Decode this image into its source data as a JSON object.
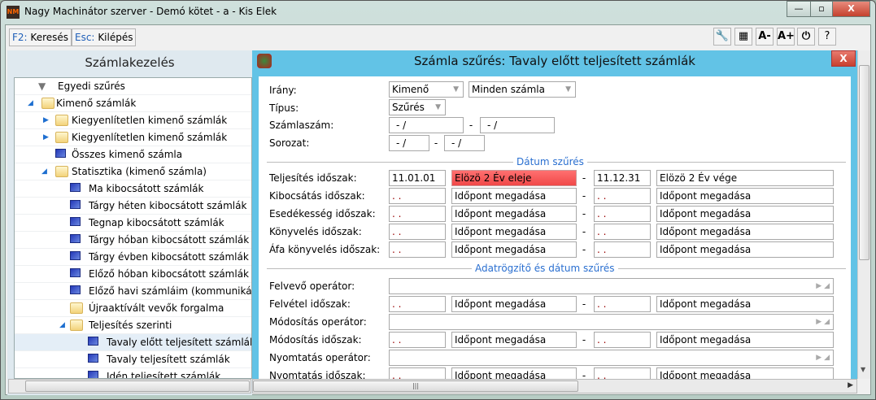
{
  "window": {
    "title": "Nagy Machinátor szerver - Demó kötet - a - Kis Elek",
    "app_icon": "NM",
    "minimize": "—",
    "maximize": "▫",
    "close": "X"
  },
  "toolbar": {
    "search_key": "F2:",
    "search_label": "Keresés",
    "exit_key": "Esc:",
    "exit_label": "Kilépés",
    "icons": {
      "settings": "wrench-icon",
      "layout": "grid-icon",
      "font_smaller": "A-",
      "font_larger": "A+",
      "power": "power-icon",
      "help": "?"
    }
  },
  "sidebar": {
    "title": "Számlakezelés",
    "items": [
      {
        "label": "Egyedi szűrés",
        "icon": "filter",
        "level": 0
      },
      {
        "label": "Kimenő számlák",
        "icon": "folder",
        "level": 0,
        "expanded": true
      },
      {
        "label": "Kiegyenlítetlen kimenő számlák",
        "icon": "folder",
        "level": 1,
        "collapsed": true
      },
      {
        "label": "Kiegyenlítetlen kimenő számlák",
        "icon": "folder",
        "level": 1,
        "collapsed": true
      },
      {
        "label": "Összes kimenő számla",
        "icon": "computer",
        "level": 1
      },
      {
        "label": "Statisztika (kimenő számla)",
        "icon": "folder",
        "level": 1,
        "expanded": true
      },
      {
        "label": "Ma kibocsátott számlák",
        "icon": "computer",
        "level": 2
      },
      {
        "label": "Tárgy héten kibocsátott számlák",
        "icon": "computer",
        "level": 2
      },
      {
        "label": "Tegnap kibocsátott számlák",
        "icon": "computer",
        "level": 2
      },
      {
        "label": "Tárgy hóban kibocsátott számlák",
        "icon": "computer",
        "level": 2
      },
      {
        "label": "Tárgy évben kibocsátott számlák",
        "icon": "computer",
        "level": 2
      },
      {
        "label": "Előző hóban kibocsátott számlák",
        "icon": "computer",
        "level": 2
      },
      {
        "label": "Előző havi számláim (kommunikáci",
        "icon": "computer",
        "level": 2
      },
      {
        "label": "Újraaktívált vevők forgalma",
        "icon": "folder",
        "level": 2
      },
      {
        "label": "Teljesítés szerinti",
        "icon": "folder",
        "level": 2,
        "expanded": true
      },
      {
        "label": "Tavaly előtt teljesített számlák",
        "icon": "computer",
        "level": 3,
        "selected": true
      },
      {
        "label": "Tavaly teljesített számlák",
        "icon": "computer",
        "level": 3
      },
      {
        "label": "Idén teljesített számlák",
        "icon": "computer",
        "level": 3
      }
    ]
  },
  "dialog": {
    "title": "Számla szűrés: Tavaly előtt teljesített számlák",
    "close": "X",
    "irany_label": "Irány:",
    "irany_value": "Kimenő",
    "irany_value2": "Minden számla",
    "tipus_label": "Típus:",
    "tipus_value": "Szűrés",
    "szamlaszam_label": "Számlaszám:",
    "szamlaszam_from": " - /",
    "szamlaszam_to": " - /",
    "sorozat_label": "Sorozat:",
    "sorozat_from": " - /",
    "sorozat_to": " - /",
    "dash": "-",
    "date_section": "Dátum szűrés",
    "date_rows": [
      {
        "label": "Teljesítés időszak:",
        "from": "11.01.01",
        "from_text": "Elözö 2 Év eleje",
        "to": "11.12.31",
        "to_text": "Elözö 2 Év vége"
      },
      {
        "label": "Kibocsátás időszak:",
        "from": " . .",
        "from_text": "Időpont megadása",
        "to": " . .",
        "to_text": "Időpont megadása"
      },
      {
        "label": "Esedékesség időszak:",
        "from": " . .",
        "from_text": "Időpont megadása",
        "to": " . .",
        "to_text": "Időpont megadása"
      },
      {
        "label": "Könyvelés időszak:",
        "from": " . .",
        "from_text": "Időpont megadása",
        "to": " . .",
        "to_text": "Időpont megadása"
      },
      {
        "label": "Áfa könyvelés időszak:",
        "from": " . .",
        "from_text": "Időpont megadása",
        "to": " . .",
        "to_text": "Időpont megadása"
      }
    ],
    "operator_section": "Adatrögzítő és dátum szűrés",
    "op_rows": [
      {
        "type": "op",
        "label": "Felvevő operátor:"
      },
      {
        "type": "date",
        "label": "Felvétel időszak:",
        "from": " . .",
        "from_text": "Időpont megadása",
        "to": " . .",
        "to_text": "Időpont megadása"
      },
      {
        "type": "op",
        "label": "Módosítás operátor:"
      },
      {
        "type": "date",
        "label": "Módosítás időszak:",
        "from": " . .",
        "from_text": "Időpont megadása",
        "to": " . .",
        "to_text": "Időpont megadása"
      },
      {
        "type": "op",
        "label": "Nyomtatás operátor:"
      },
      {
        "type": "date",
        "label": "Nyomtatás időszak:",
        "from": " . .",
        "from_text": "Időpont megadása",
        "to": " . .",
        "to_text": "Időpont megadása"
      }
    ]
  }
}
